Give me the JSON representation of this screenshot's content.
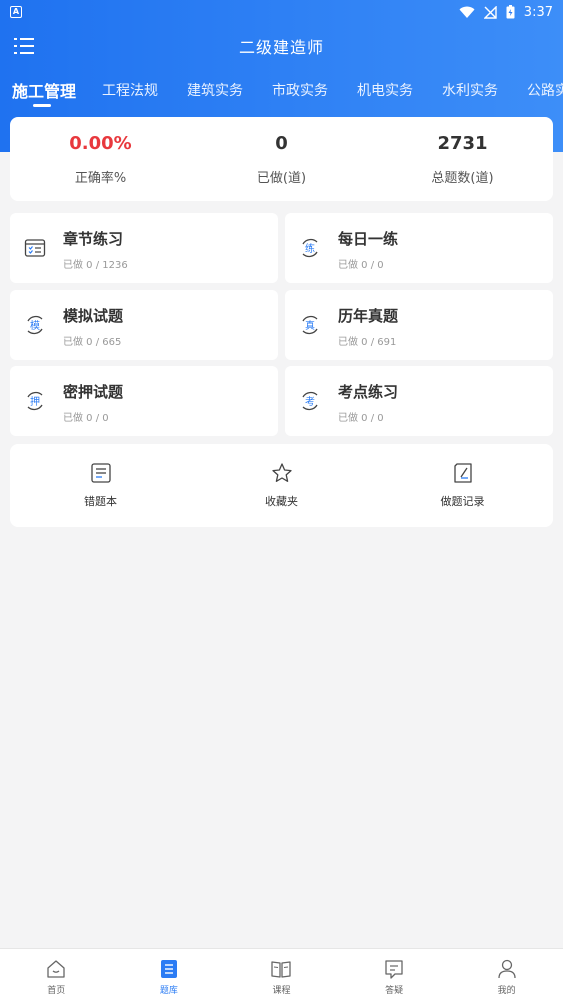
{
  "status_bar": {
    "badge": "A",
    "time": "3:37"
  },
  "header": {
    "title": "二级建造师"
  },
  "tabs": [
    {
      "label": "施工管理",
      "active": true
    },
    {
      "label": "工程法规"
    },
    {
      "label": "建筑实务"
    },
    {
      "label": "市政实务"
    },
    {
      "label": "机电实务"
    },
    {
      "label": "水利实务"
    },
    {
      "label": "公路实"
    }
  ],
  "stats": [
    {
      "value": "0.00%",
      "label": "正确率%"
    },
    {
      "value": "0",
      "label": "已做(道)"
    },
    {
      "value": "2731",
      "label": "总题数(道)"
    }
  ],
  "practice": [
    {
      "title": "章节练习",
      "progress": "已做  0 / 1236",
      "icon": "list-check-icon"
    },
    {
      "title": "每日一练",
      "progress": "已做  0 / 0",
      "icon": "lian-char-icon",
      "glyph": "练"
    },
    {
      "title": "模拟试题",
      "progress": "已做  0 / 665",
      "icon": "mo-char-icon",
      "glyph": "模"
    },
    {
      "title": "历年真题",
      "progress": "已做  0 / 691",
      "icon": "zhen-char-icon",
      "glyph": "真"
    },
    {
      "title": "密押试题",
      "progress": "已做  0 / 0",
      "icon": "ya-char-icon",
      "glyph": "押"
    },
    {
      "title": "考点练习",
      "progress": "已做  0 / 0",
      "icon": "kao-char-icon",
      "glyph": "考"
    }
  ],
  "tools": [
    {
      "label": "错题本",
      "icon": "notebook-icon"
    },
    {
      "label": "收藏夹",
      "icon": "star-icon"
    },
    {
      "label": "做题记录",
      "icon": "record-icon"
    }
  ],
  "nav": [
    {
      "label": "首页",
      "icon": "home-icon"
    },
    {
      "label": "题库",
      "icon": "question-bank-icon",
      "active": true
    },
    {
      "label": "课程",
      "icon": "book-icon"
    },
    {
      "label": "答疑",
      "icon": "chat-icon"
    },
    {
      "label": "我的",
      "icon": "user-icon"
    }
  ],
  "colors": {
    "primary": "#2b7cf4",
    "accent_red": "#e8383d"
  }
}
